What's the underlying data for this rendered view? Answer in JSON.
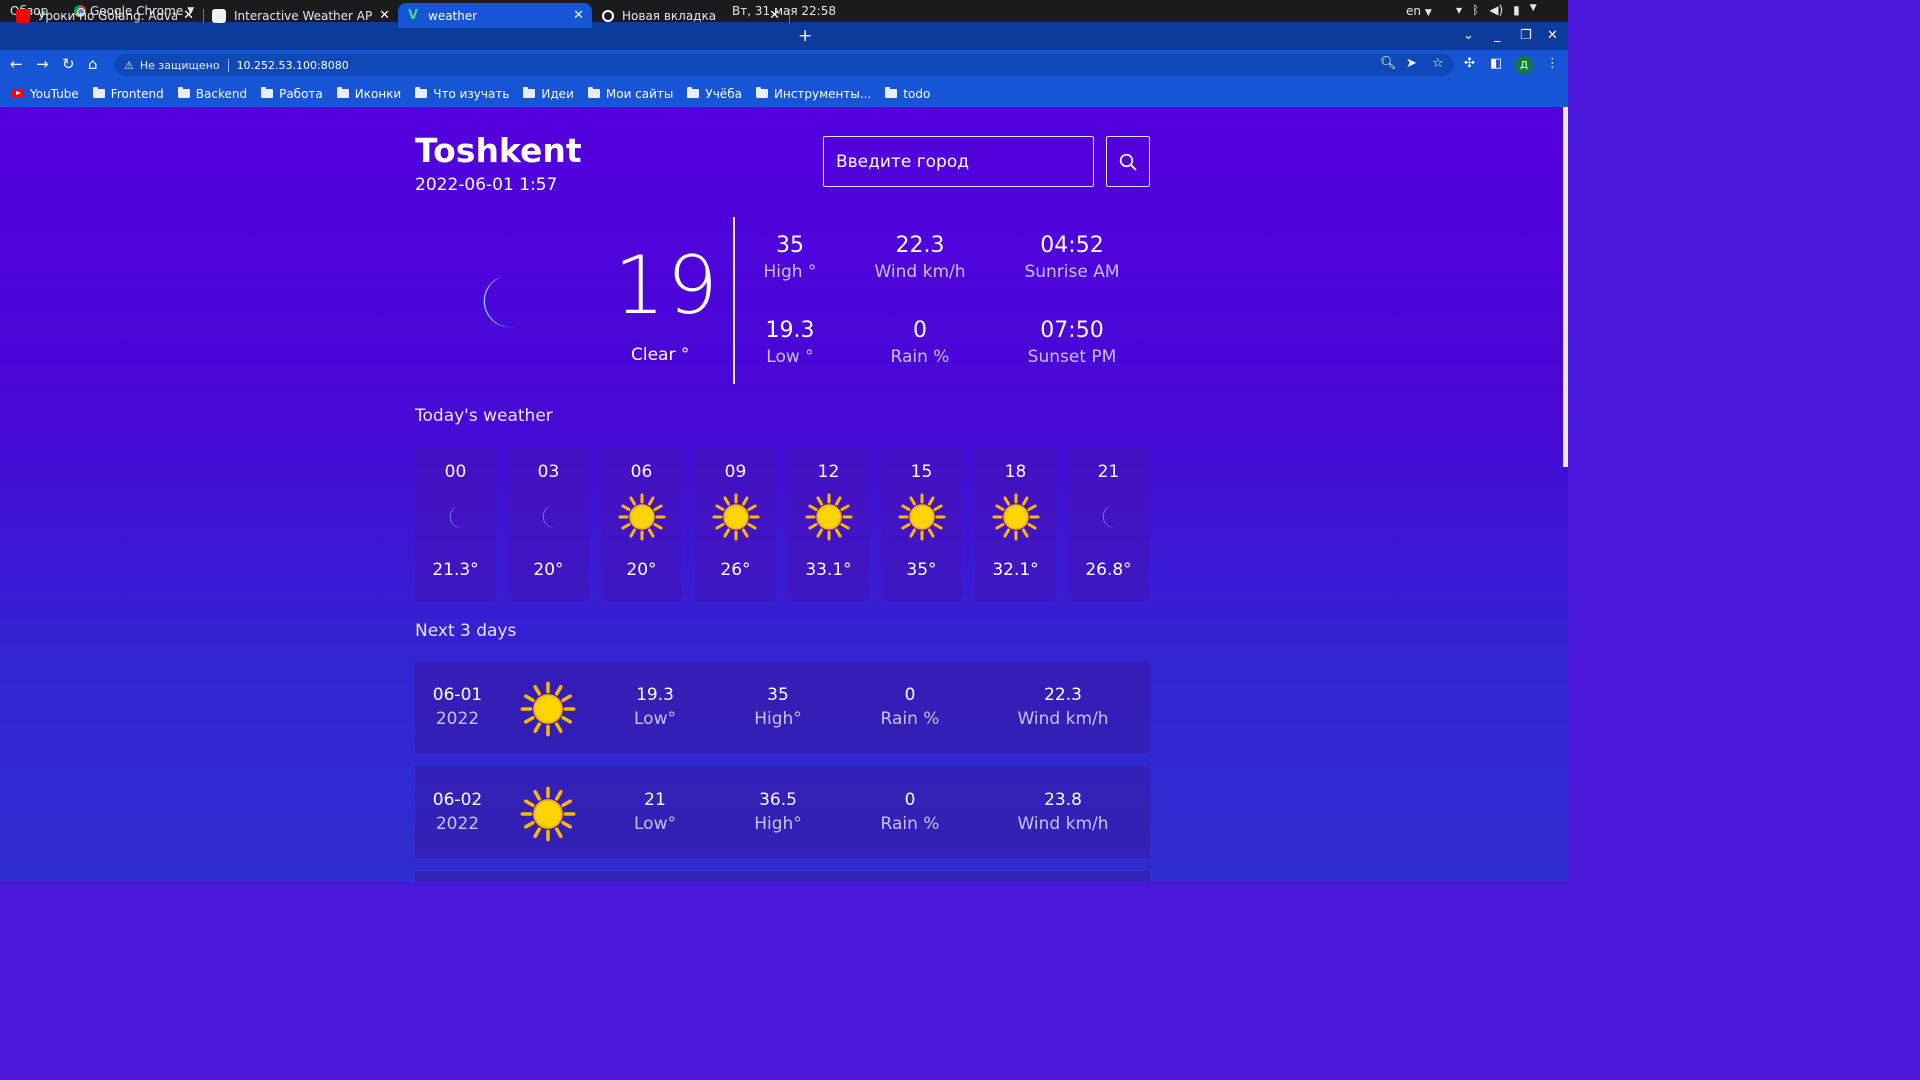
{
  "system_bar": {
    "activities": "Обзор",
    "app_name": "Google Chrome",
    "clock": "Вт, 31 мая  22:58",
    "lang": "en"
  },
  "tabs": [
    {
      "title": "Уроки по Golang. Advanc",
      "active": false,
      "icon": "youtube-icon"
    },
    {
      "title": "Interactive Weather API E",
      "active": false,
      "icon": "page-icon"
    },
    {
      "title": "weather",
      "active": true,
      "icon": "vue-icon"
    },
    {
      "title": "Новая вкладка",
      "active": false,
      "icon": "chrome-icon"
    }
  ],
  "address_bar": {
    "security": "Не защищено",
    "url": "10.252.53.100:8080"
  },
  "bookmarks": [
    "YouTube",
    "Frontend",
    "Backend",
    "Работа",
    "Иконки",
    "Что изучать",
    "Идеи",
    "Мои сайты",
    "Учёба",
    "Инструменты...",
    "todo"
  ],
  "weather": {
    "city": "Toshkent",
    "datetime": "2022-06-01 1:57",
    "search_placeholder": "Введите город",
    "current": {
      "temp": "19",
      "condition": "Clear °",
      "icon": "moon-icon"
    },
    "stats": {
      "high": {
        "value": "35",
        "label": "High °"
      },
      "wind": {
        "value": "22.3",
        "label": "Wind km/h"
      },
      "sunrise": {
        "value": "04:52",
        "label": "Sunrise AM"
      },
      "low": {
        "value": "19.3",
        "label": "Low °"
      },
      "rain": {
        "value": "0",
        "label": "Rain %"
      },
      "sunset": {
        "value": "07:50",
        "label": "Sunset PM"
      }
    },
    "today_title": "Today's weather",
    "hourly": [
      {
        "hour": "00",
        "icon": "moon",
        "temp": "21.3°"
      },
      {
        "hour": "03",
        "icon": "moon",
        "temp": "20°"
      },
      {
        "hour": "06",
        "icon": "sun",
        "temp": "20°"
      },
      {
        "hour": "09",
        "icon": "sun",
        "temp": "26°"
      },
      {
        "hour": "12",
        "icon": "sun",
        "temp": "33.1°"
      },
      {
        "hour": "15",
        "icon": "sun",
        "temp": "35°"
      },
      {
        "hour": "18",
        "icon": "sun",
        "temp": "32.1°"
      },
      {
        "hour": "21",
        "icon": "moon",
        "temp": "26.8°"
      }
    ],
    "next_title": "Next 3 days",
    "days": [
      {
        "date": "06-01",
        "year": "2022",
        "icon": "sun",
        "low": "19.3",
        "low_label": "Low°",
        "high": "35",
        "high_label": "High°",
        "rain": "0",
        "rain_label": "Rain %",
        "wind": "22.3",
        "wind_label": "Wind km/h"
      },
      {
        "date": "06-02",
        "year": "2022",
        "icon": "sun",
        "low": "21",
        "low_label": "Low°",
        "high": "36.5",
        "high_label": "High°",
        "rain": "0",
        "rain_label": "Rain %",
        "wind": "23.8",
        "wind_label": "Wind km/h"
      }
    ]
  }
}
